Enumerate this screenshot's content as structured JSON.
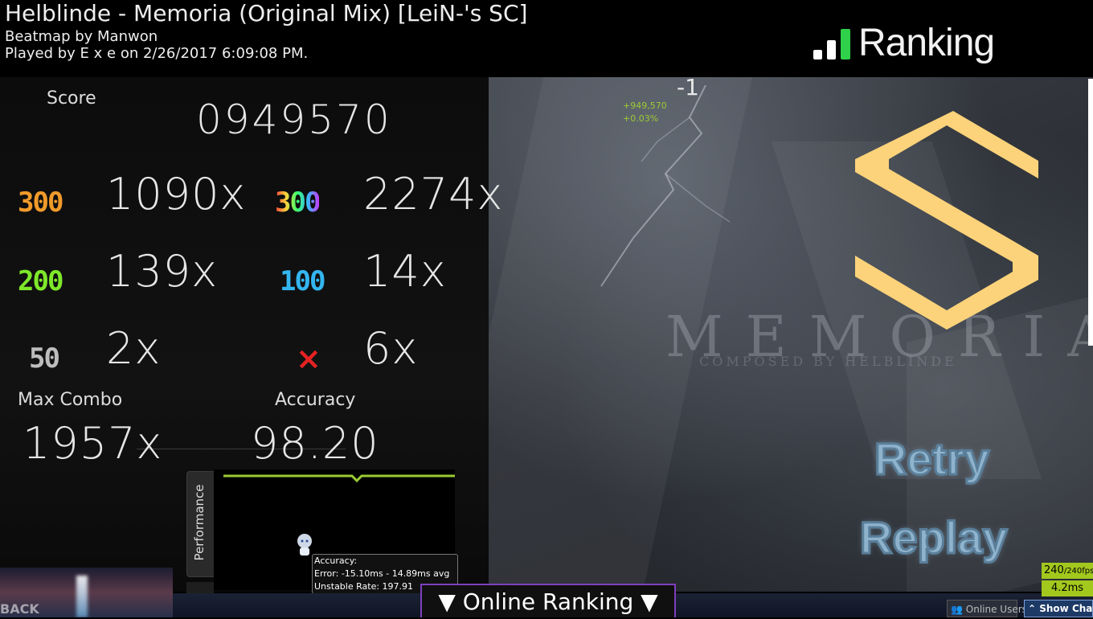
{
  "header": {
    "song_title": "Helblinde - Memoria (Original Mix) [LeiN-'s SC]",
    "beatmap_by": "Beatmap by Manwon",
    "played_by": "Played by E x e on 2/26/2017 6:09:08 PM.",
    "ranking_title": "Ranking"
  },
  "score": {
    "label": "Score",
    "value": "0949570"
  },
  "judgements": {
    "j300": {
      "label": "300",
      "count": "1090x"
    },
    "geki": {
      "label": "300",
      "count": "2274x"
    },
    "j200": {
      "label": "200",
      "count": "139x"
    },
    "j100": {
      "label": "100",
      "count": "14x"
    },
    "j50": {
      "label": "50",
      "count": "2x"
    },
    "miss": {
      "label": "×",
      "count": "6x"
    }
  },
  "max_combo": {
    "label": "Max Combo",
    "value": "1957x"
  },
  "accuracy": {
    "label": "Accuracy",
    "value": "98.20"
  },
  "performance_tab": {
    "label": "Performance"
  },
  "tooltip": {
    "line1": "Accuracy:",
    "line2": "Error: -15.10ms - 14.89ms avg",
    "line3": "Unstable Rate: 197.91"
  },
  "right": {
    "combo_delta": "-1",
    "score_gain": "+949,570",
    "percent_gain": "+0.03%",
    "grade": "S",
    "retry_label": "Retry",
    "replay_label": "Replay",
    "bg_title": "MEMORIA",
    "bg_composed": "COMPOSED BY HELBLINDE"
  },
  "bottom": {
    "back_label": "BACK",
    "online_ranking_label": "▼ Online Ranking ▼",
    "online_users_label": "Online Users",
    "show_chat_label": "Show Chat"
  },
  "perf": {
    "fps": "240",
    "fps_cap": "/240fps",
    "latency": "4.2ms"
  },
  "colors": {
    "grade_s": "#fcd37a",
    "judge_300": "#f09a2a",
    "judge_200": "#7ee82a",
    "judge_100": "#33b6f0",
    "judge_miss": "#e52222",
    "graph_line": "#9acb34",
    "online_ranking_border": "#7f3fbf"
  }
}
